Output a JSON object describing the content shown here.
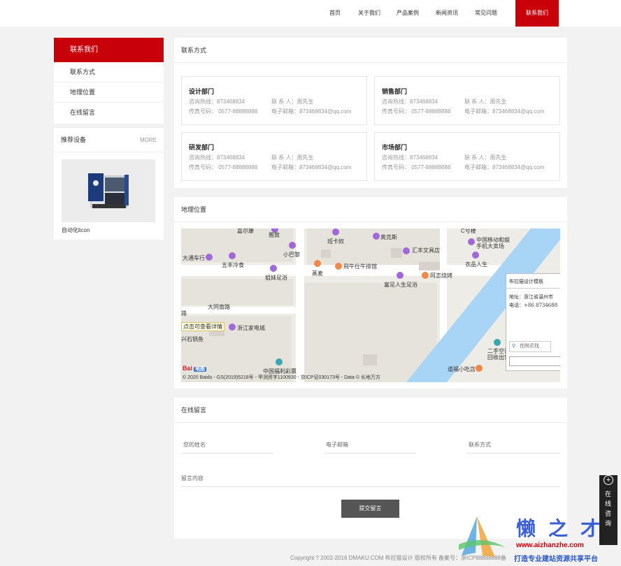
{
  "nav": {
    "items": [
      "首页",
      "关于我们",
      "产品案例",
      "新闻资讯",
      "常见问题",
      "联系我们"
    ],
    "active_label": "联系我们"
  },
  "sidebar": {
    "title": "联系我们",
    "links": [
      "联系方式",
      "地理位置",
      "在线留言"
    ],
    "recommend_title": "推荐设备",
    "more_label": "MORE",
    "item_label": "自动化licon"
  },
  "contact": {
    "title": "联系方式",
    "cards": [
      {
        "dept": "设计部门",
        "hotline": "咨询热线：873468834",
        "contact": "联 系 人：周先生",
        "fax": "传真号码：  0577-88888888",
        "email": "电子邮箱：873468834@qq.com"
      },
      {
        "dept": "销售部门",
        "hotline": "咨询热线：873468834",
        "contact": "联 系 人：周先生",
        "fax": "传真号码：  0577-88888888",
        "email": "电子邮箱：873468834@qq.com"
      },
      {
        "dept": "研发部门",
        "hotline": "咨询热线：873468834",
        "contact": "联 系 人：周先生",
        "fax": "传真号码：  0577-88888888",
        "email": "电子邮箱：873468834@qq.com"
      },
      {
        "dept": "市场部门",
        "hotline": "咨询热线：873468834",
        "contact": "联 系 人：周先生",
        "fax": "传真号码：  0577-88888888",
        "email": "电子邮箱：873468834@qq.com"
      }
    ]
  },
  "location": {
    "title": "地理位置",
    "map_labels": {
      "l1": "雅致",
      "l2": "班卡奴",
      "l3": "奥克斯",
      "l4": "中国移动和娱",
      "l5": "手机大卖场",
      "l6": "大通车行",
      "l7": "五丰冷食",
      "l8": "小巴黎",
      "l9": "汇丰文具店",
      "l10": "衣品人生",
      "l11": "姐妹足浴",
      "l12": "蒸麦",
      "l13": "飛牛仕牛排馆",
      "l14": "富足人生足浴",
      "l15": "阿志烧烤",
      "l16": "大同南路",
      "l17": "浙江家电城",
      "l18": "兴石锅鱼",
      "l19": "中国福利彩票",
      "l20": "二手空调",
      "l21": "回收出售",
      "l22": "道福小吃店",
      "l23": "路",
      "l24": "C号楼",
      "l25": "嘉尔康"
    },
    "hint": "点击可查看详情",
    "copyright": "© 2020 Baidu - GS(2019)5218号 - 甲测资字1100930 - 京ICP证030173号 - Data © 长地万方",
    "logo_text": "Bai",
    "logo_badge": "地图",
    "infowin": {
      "title": "布拉猫设计模板",
      "addr_label": "地址：",
      "addr": "浙江省温州市",
      "tel_label": "电话：",
      "tel": "+86 8734688",
      "search": "在附近找"
    }
  },
  "message": {
    "title": "在线留言",
    "name_placeholder": "您的姓名",
    "email_placeholder": "电子邮箱",
    "phone_placeholder": "联系方式",
    "content_placeholder": "留言内容",
    "submit": "提交留言"
  },
  "footer": {
    "copyright": "Copyright ? 2002-2016 DMAKU.COM 布拉猫设计 版权所有 备案号：浙ICP88888888备"
  },
  "float": {
    "text": "在线咨询"
  },
  "watermark": {
    "big": "懒之才",
    "url": "www.aizhanzhe.com",
    "tag": "打造专业建站资源共享平台"
  },
  "colors": {
    "accent": "#c8000a",
    "button": "#555555",
    "river": "#a8d4f5"
  }
}
